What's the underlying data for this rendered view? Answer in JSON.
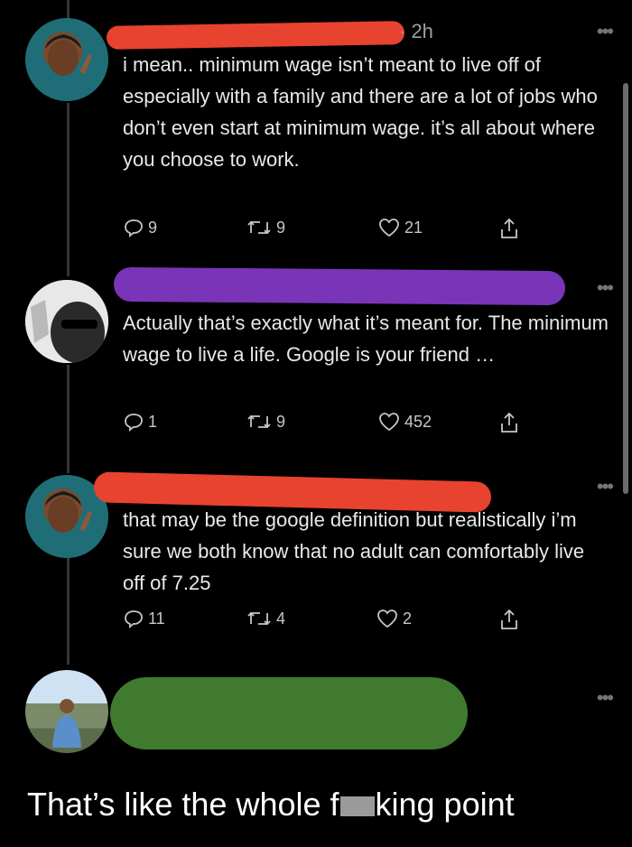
{
  "tweets": [
    {
      "time": "· 2h",
      "text": "i mean.. minimum wage isn’t meant to live off of especially with a family and there are a lot of jobs who don’t even start at minimum wage. it’s all about where you choose to work.",
      "replies": "9",
      "retweets": "9",
      "likes": "21",
      "redaction_color": "#e8432f"
    },
    {
      "time": "",
      "text": "Actually that’s exactly what it’s meant for. The minimum wage to live a life. Google is your friend …",
      "replies": "1",
      "retweets": "9",
      "likes": "452",
      "redaction_color": "#7a34b8"
    },
    {
      "time": "",
      "text": "that may be the google definition but realistically i’m sure we both know that no adult can comfortably live off of 7.25",
      "replies": "11",
      "retweets": "4",
      "likes": "2",
      "redaction_color": "#e8432f"
    },
    {
      "time": "",
      "text": "",
      "redaction_color": "#3f7a2e"
    }
  ],
  "more_glyph": "•••",
  "caption": {
    "before": "That’s like the whole f",
    "after": "king point"
  },
  "icons": [
    "reply-icon",
    "retweet-icon",
    "like-icon",
    "share-icon"
  ]
}
